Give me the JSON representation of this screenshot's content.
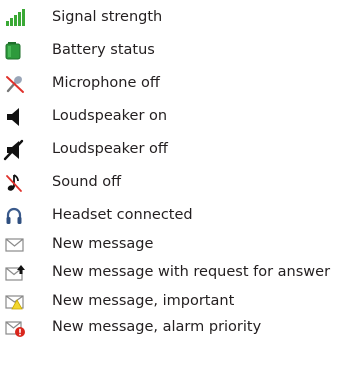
{
  "colors": {
    "signal_green": "#3aa935",
    "battery_green": "#2d9a3c",
    "battery_dark": "#1e6f2a",
    "speaker_black": "#111111",
    "mute_red": "#e0312b",
    "headset_blue": "#3a5a8c",
    "envelope_gray": "#8a8a8a",
    "important_yellow": "#f2d630",
    "alarm_red": "#d9261c",
    "text": "#231f20"
  },
  "legend": {
    "items": [
      {
        "icon": "signal-strength-icon",
        "label": "Signal strength"
      },
      {
        "icon": "battery-status-icon",
        "label": "Battery status"
      },
      {
        "icon": "microphone-off-icon",
        "label": "Microphone off"
      },
      {
        "icon": "loudspeaker-on-icon",
        "label": "Loudspeaker on"
      },
      {
        "icon": "loudspeaker-off-icon",
        "label": "Loudspeaker off"
      },
      {
        "icon": "sound-off-icon",
        "label": "Sound off"
      },
      {
        "icon": "headset-connected-icon",
        "label": "Headset connected"
      },
      {
        "icon": "new-message-icon",
        "label": "New message"
      },
      {
        "icon": "message-request-answer-icon",
        "label": "New message with request for answer"
      },
      {
        "icon": "message-important-icon",
        "label": "New message, important"
      },
      {
        "icon": "message-alarm-priority-icon",
        "label": "New message, alarm priority"
      }
    ]
  }
}
